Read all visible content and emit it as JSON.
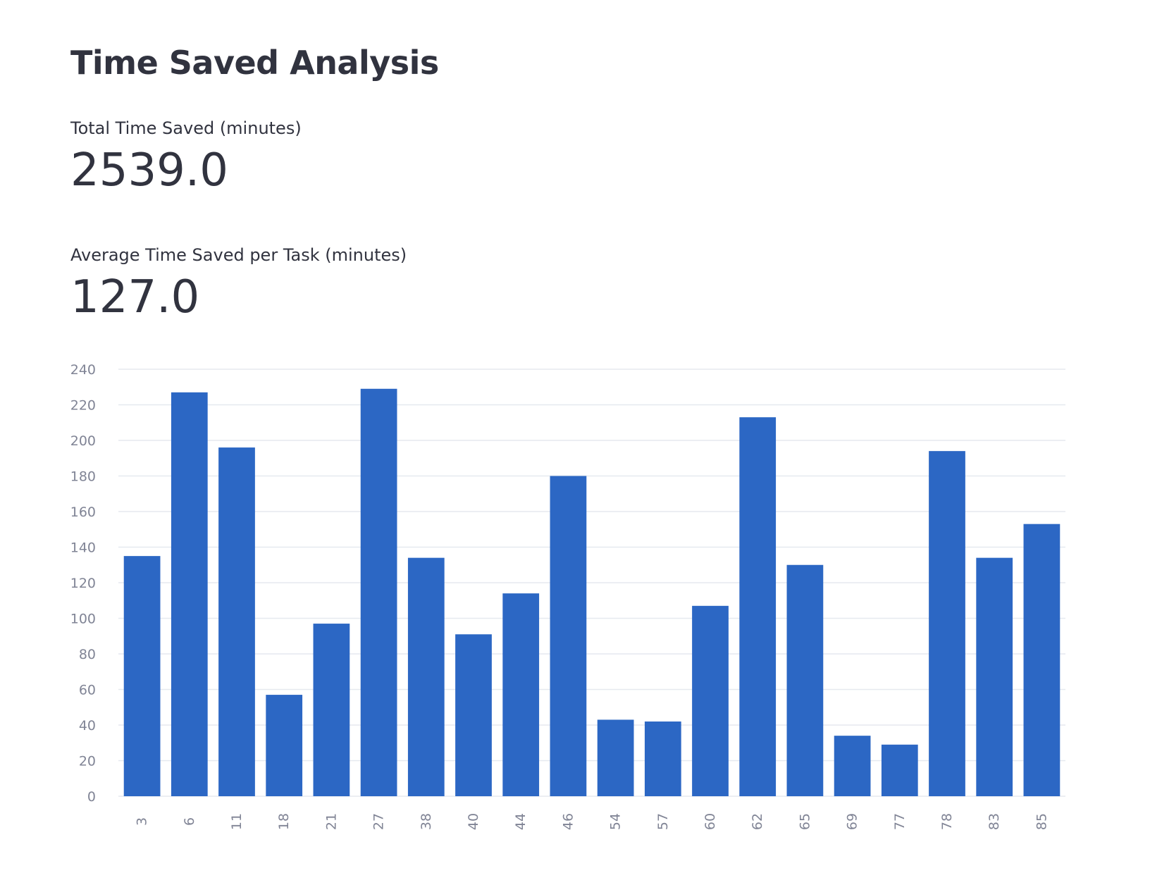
{
  "page": {
    "title": "Time Saved Analysis"
  },
  "metrics": [
    {
      "label": "Total Time Saved (minutes)",
      "value": "2539.0"
    },
    {
      "label": "Average Time Saved per Task (minutes)",
      "value": "127.0"
    }
  ],
  "chart_data": {
    "type": "bar",
    "categories": [
      "3",
      "6",
      "11",
      "18",
      "21",
      "27",
      "38",
      "40",
      "44",
      "46",
      "54",
      "57",
      "60",
      "62",
      "65",
      "69",
      "77",
      "78",
      "83",
      "85"
    ],
    "values": [
      135,
      227,
      196,
      57,
      97,
      229,
      134,
      91,
      114,
      180,
      43,
      42,
      107,
      213,
      130,
      34,
      29,
      194,
      134,
      153
    ],
    "ylim": [
      0,
      240
    ],
    "yticks": [
      0,
      20,
      40,
      60,
      80,
      100,
      120,
      140,
      160,
      180,
      200,
      220,
      240
    ],
    "xlabel": "",
    "ylabel": "",
    "grid": true,
    "bar_color": "#2c67c4",
    "grid_color": "#e6e9ef"
  }
}
